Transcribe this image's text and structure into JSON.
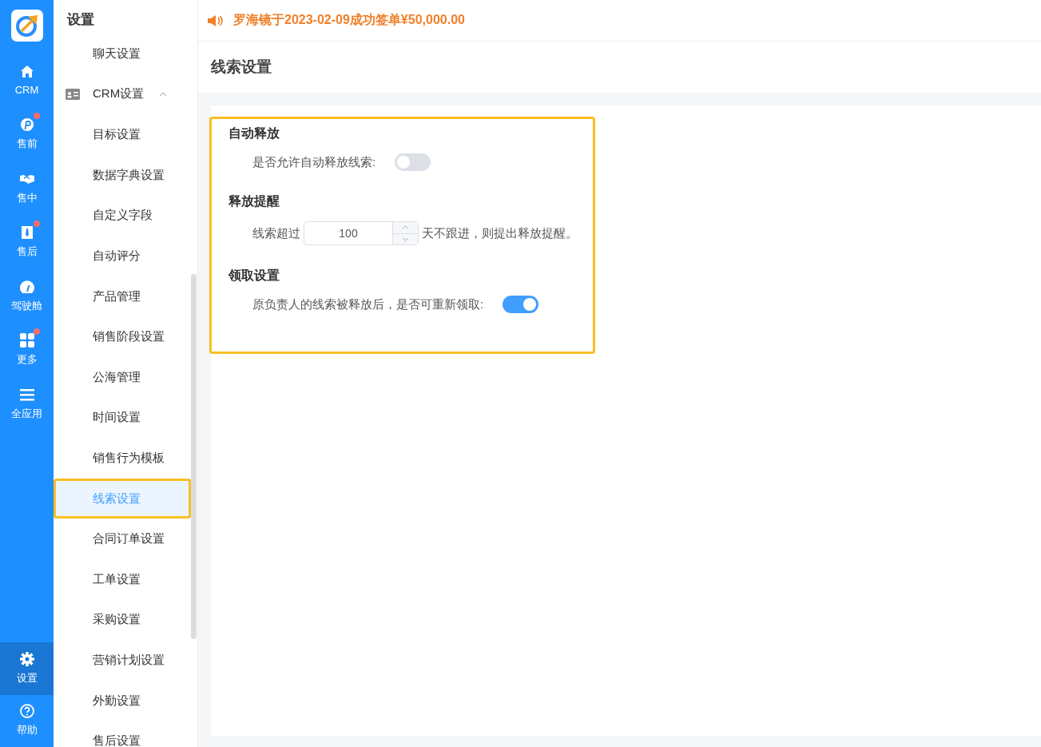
{
  "rail": {
    "items": [
      {
        "label": "CRM",
        "badge": false,
        "selected": false
      },
      {
        "label": "售前",
        "badge": true,
        "selected": false
      },
      {
        "label": "售中",
        "badge": false,
        "selected": false
      },
      {
        "label": "售后",
        "badge": true,
        "selected": false
      },
      {
        "label": "驾驶舱",
        "badge": false,
        "selected": false
      },
      {
        "label": "更多",
        "badge": true,
        "selected": false
      },
      {
        "label": "全应用",
        "badge": false,
        "selected": false
      }
    ],
    "bottom_items": [
      {
        "label": "设置",
        "badge": false,
        "selected": true
      },
      {
        "label": "帮助",
        "badge": false,
        "selected": false
      }
    ]
  },
  "sidebar": {
    "title": "设置",
    "items": [
      {
        "label": "聊天设置",
        "kind": "item",
        "selected": false
      },
      {
        "label": "CRM设置",
        "kind": "group",
        "expanded": true,
        "children": [
          {
            "label": "目标设置",
            "selected": false
          },
          {
            "label": "数据字典设置",
            "selected": false
          },
          {
            "label": "自定义字段",
            "selected": false
          },
          {
            "label": "自动评分",
            "selected": false
          },
          {
            "label": "产品管理",
            "selected": false
          },
          {
            "label": "销售阶段设置",
            "selected": false
          },
          {
            "label": "公海管理",
            "selected": false
          },
          {
            "label": "时间设置",
            "selected": false
          },
          {
            "label": "销售行为模板",
            "selected": false
          },
          {
            "label": "线索设置",
            "selected": true,
            "highlighted": true
          },
          {
            "label": "合同订单设置",
            "selected": false
          },
          {
            "label": "工单设置",
            "selected": false
          },
          {
            "label": "采购设置",
            "selected": false
          },
          {
            "label": "营销计划设置",
            "selected": false
          },
          {
            "label": "外勤设置",
            "selected": false
          },
          {
            "label": "售后设置",
            "selected": false
          }
        ]
      }
    ]
  },
  "announcement": "罗海镜于2023-02-09成功签单¥50,000.00",
  "page_title": "线索设置",
  "sections": [
    {
      "heading": "自动释放",
      "rows": [
        {
          "kind": "switch",
          "label": "是否允许自动释放线索:",
          "on": false
        }
      ]
    },
    {
      "heading": "释放提醒",
      "rows": [
        {
          "kind": "number",
          "label": "线索超过",
          "value": "100",
          "suffix": "天不跟进，则提出释放提醒。"
        }
      ]
    },
    {
      "heading": "领取设置",
      "rows": [
        {
          "kind": "switch",
          "label": "原负责人的线索被释放后，是否可重新领取:",
          "on": true
        }
      ]
    }
  ]
}
